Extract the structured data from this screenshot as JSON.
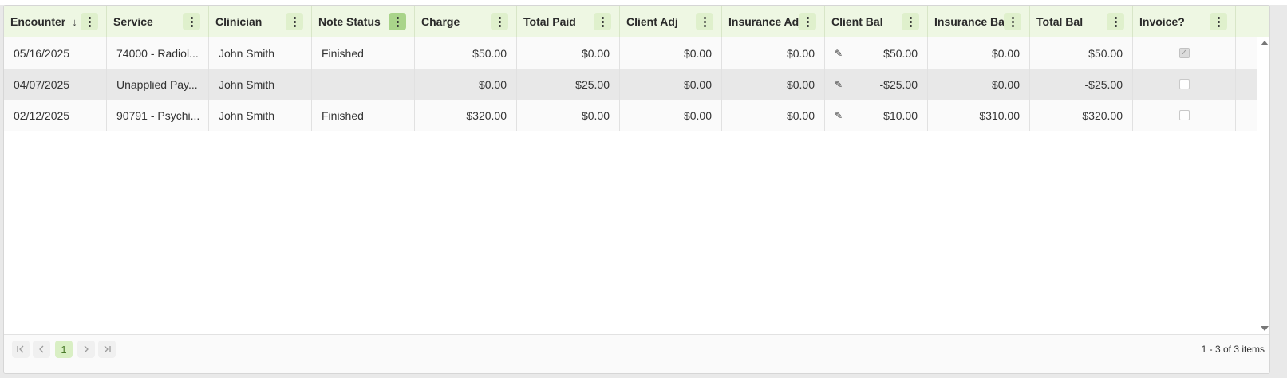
{
  "columns": [
    {
      "label": "Encounter",
      "sort": "↓"
    },
    {
      "label": "Service"
    },
    {
      "label": "Clinician"
    },
    {
      "label": "Note Status"
    },
    {
      "label": "Charge"
    },
    {
      "label": "Total Paid"
    },
    {
      "label": "Client Adj"
    },
    {
      "label": "Insurance Adj"
    },
    {
      "label": "Client Bal"
    },
    {
      "label": "Insurance Bal"
    },
    {
      "label": "Total Bal"
    },
    {
      "label": "Invoice?"
    }
  ],
  "rows": [
    {
      "encounter": "05/16/2025",
      "service": "74000 - Radiol...",
      "clinician": "John Smith",
      "note_status": "Finished",
      "charge": "$50.00",
      "total_paid": "$0.00",
      "client_adj": "$0.00",
      "insurance_adj": "$0.00",
      "client_bal": "$50.00",
      "insurance_bal": "$0.00",
      "total_bal": "$50.00",
      "invoice": true
    },
    {
      "encounter": "04/07/2025",
      "service": "Unapplied Pay...",
      "clinician": "John Smith",
      "note_status": "",
      "charge": "$0.00",
      "total_paid": "$25.00",
      "client_adj": "$0.00",
      "insurance_adj": "$0.00",
      "client_bal": "-$25.00",
      "insurance_bal": "$0.00",
      "total_bal": "-$25.00",
      "invoice": false
    },
    {
      "encounter": "02/12/2025",
      "service": "90791 - Psychi...",
      "clinician": "John Smith",
      "note_status": "Finished",
      "charge": "$320.00",
      "total_paid": "$0.00",
      "client_adj": "$0.00",
      "insurance_adj": "$0.00",
      "client_bal": "$10.00",
      "insurance_bal": "$310.00",
      "total_bal": "$320.00",
      "invoice": false
    }
  ],
  "pagination": {
    "current_page": "1",
    "info": "1 - 3 of 3 items"
  },
  "icons": {
    "pencil": "✎",
    "check": "✓"
  }
}
